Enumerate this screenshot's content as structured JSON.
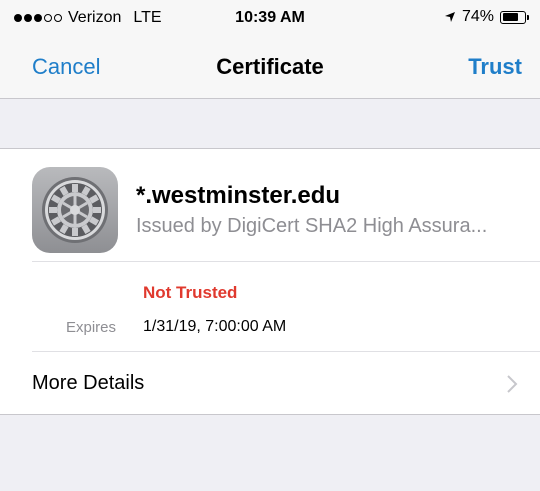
{
  "status_bar": {
    "signal_filled": 3,
    "signal_total": 5,
    "carrier": "Verizon",
    "network": "LTE",
    "time": "10:39 AM",
    "location_icon": "location-arrow-icon",
    "battery_percent": "74%",
    "battery_level": 0.74
  },
  "nav": {
    "cancel_label": "Cancel",
    "title": "Certificate",
    "trust_label": "Trust"
  },
  "certificate": {
    "icon": "gear-icon",
    "name": "*.westminster.edu",
    "issuer": "Issued by DigiCert SHA2 High Assura...",
    "trust_status": "Not Trusted",
    "expires_label": "Expires",
    "expires_value": "1/31/19, 7:00:00 AM"
  },
  "details": {
    "label": "More Details",
    "chevron_icon": "chevron-right-icon"
  },
  "colors": {
    "accent": "#1f7ec9",
    "danger": "#e0392e",
    "secondary_text": "#8e8e93",
    "background": "#efeff4"
  }
}
